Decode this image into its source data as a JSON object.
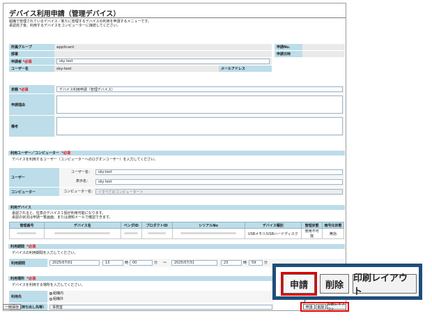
{
  "page": {
    "title": "デバイス利用申請（管理デバイス）",
    "desc_line1": "組織で管理されているデバイス／新たに管理するデバイスの利用を申請するメニューです。",
    "desc_line2": "承認完了後、利用するデバイスをコンピューターに接続してください。"
  },
  "applicant": {
    "group_label": "所属グループ",
    "group_value": "applicant",
    "dept_label": "部署",
    "dept_value": "",
    "applicant_label": "申請者",
    "applicant_value": "sky test",
    "username_label": "ユーザー名",
    "username_value": "sky-test",
    "mail_label": "メールアドレス",
    "mail_value": "",
    "no_label": "申請No.",
    "no_value": "",
    "datetime_label": "申請日時",
    "datetime_value": ""
  },
  "required_mark": "*必須",
  "form": {
    "subject_label": "表題",
    "subject_value": "デバイス利用申請（管理デバイス）",
    "reason_label": "申請理由",
    "note_label": "備考"
  },
  "user_section": {
    "title": "利用ユーザー／コンピューター",
    "desc": "デバイスを利用するユーザー（コンピューターへのログオンユーザー）を入力してください。",
    "user_label": "ユーザー",
    "username_caption": "ユーザー名：",
    "username_value": "sky-test",
    "display_caption": "表示名：",
    "display_value": "sky test",
    "computer_label": "コンピューター",
    "computer_caption": "コンピューター名：",
    "computer_value": "＜すべてのコンピューター＞"
  },
  "device_section": {
    "title": "利用デバイス",
    "desc1": "承認されると、任意のデバイス１個が利用可能になります。",
    "desc2": "承認の状況は申請一覧画面、または通知メールで確認できます。",
    "columns": [
      "管理番号",
      "デバイス名",
      "ベンダID",
      "プロダクトID",
      "シリアルNo",
      "デバイス種別",
      "管理状態",
      "暗号化状態"
    ],
    "row": {
      "type": "USBメモリ/USBハードディスク",
      "status": "使用不可能",
      "encryption": "無効"
    }
  },
  "period_section": {
    "title": "利用期間",
    "desc": "デバイスの利用期間を入力してください。",
    "label": "利用期間",
    "start_date": "2025/07/01",
    "start_hour": "13",
    "start_min": "00",
    "hour_unit": "時",
    "min_unit": "分",
    "tilde": "～",
    "end_date": "2025/07/31",
    "end_hour": "23",
    "end_min": "59"
  },
  "place_section": {
    "title": "利用場所",
    "desc": "デバイスを利用する場所を入力してください。",
    "place_label": "利用先",
    "option1": "組織内",
    "option2": "組織外",
    "detail_label": "詳細（持ち出し先等）",
    "detail_value": "事務室"
  },
  "footer": {
    "save": "一時保存",
    "apply": "申請",
    "delete": "削除",
    "print": "印刷レイアウト"
  },
  "zoom": {
    "apply": "申請",
    "delete": "削除",
    "print": "印刷レイアウト"
  }
}
